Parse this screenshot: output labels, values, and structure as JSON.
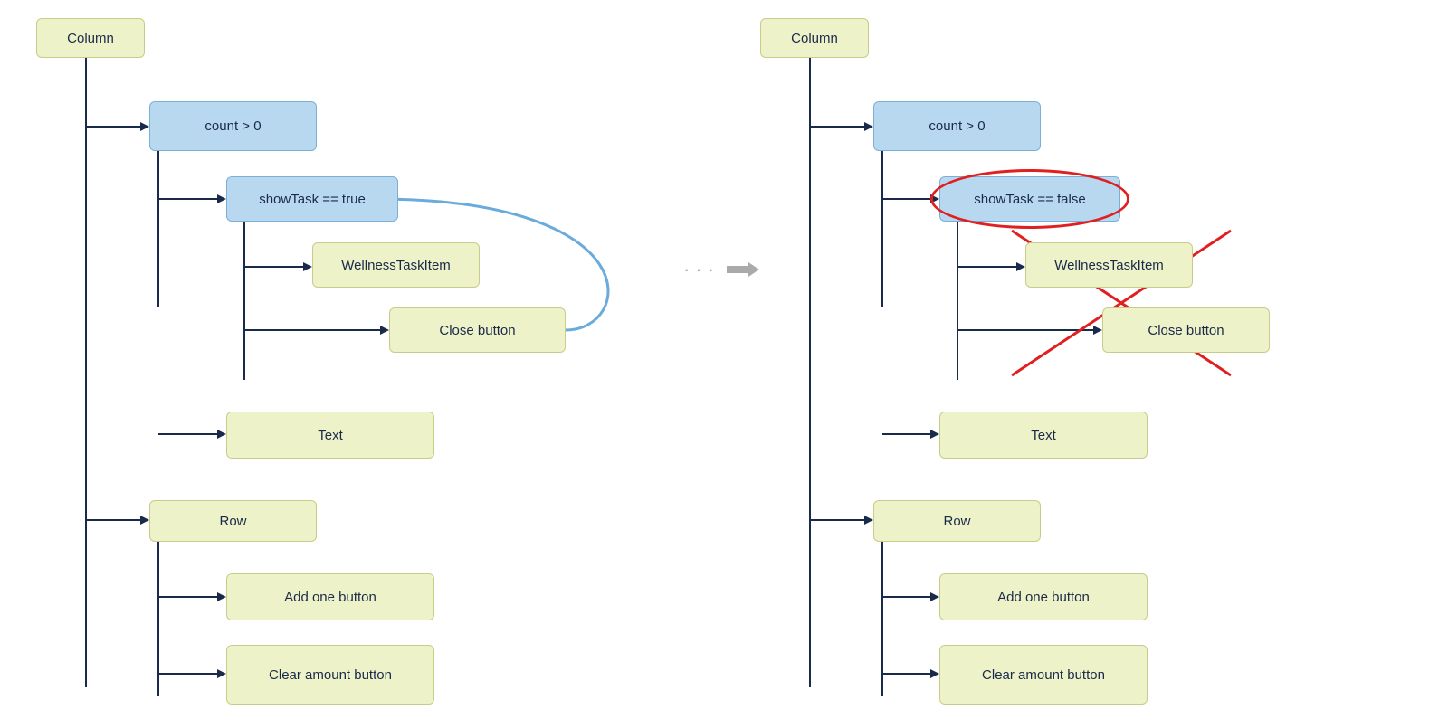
{
  "left": {
    "title": "Column",
    "count_node": "count > 0",
    "show_task_node": "showTask == true",
    "wellness_node": "WellnessTaskItem",
    "close_node": "Close button",
    "text_node": "Text",
    "row_node": "Row",
    "add_one_node": "Add one button",
    "clear_node": "Clear amount button"
  },
  "right": {
    "title": "Column",
    "count_node": "count > 0",
    "show_task_node": "showTask == false",
    "wellness_node": "WellnessTaskItem",
    "close_node": "Close button",
    "text_node": "Text",
    "row_node": "Row",
    "add_one_node": "Add one button",
    "clear_node": "Clear amount button"
  },
  "separator": "···"
}
